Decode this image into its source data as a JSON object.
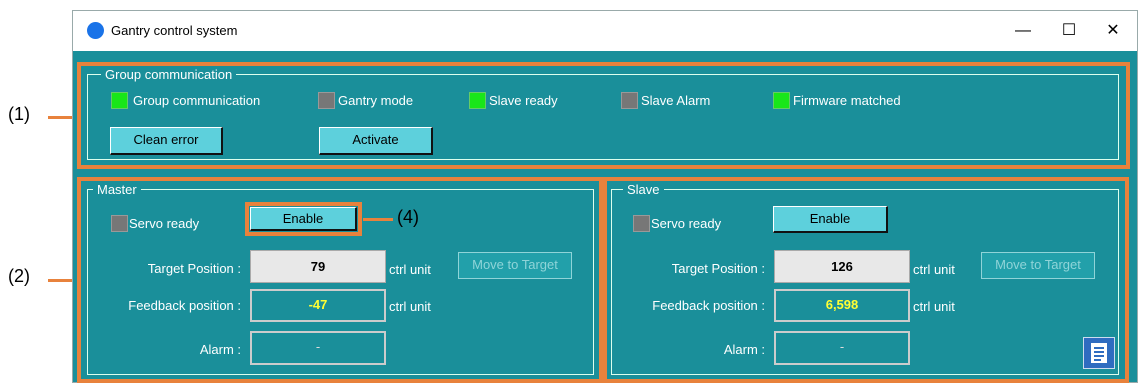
{
  "window": {
    "title": "Gantry control system",
    "minimize": "—",
    "maximize": "☐",
    "close": "✕"
  },
  "callouts": {
    "c1": "(1)",
    "c2": "(2)",
    "c4": "(4)"
  },
  "group_comm": {
    "legend": "Group communication",
    "indicators": [
      {
        "label": "Group communication",
        "state": "on"
      },
      {
        "label": "Gantry mode",
        "state": "off"
      },
      {
        "label": "Slave ready",
        "state": "on"
      },
      {
        "label": "Slave Alarm",
        "state": "off"
      },
      {
        "label": "Firmware matched",
        "state": "on"
      }
    ],
    "clean_error": "Clean error",
    "activate": "Activate"
  },
  "master": {
    "legend": "Master",
    "servo_ready": "Servo ready",
    "enable": "Enable",
    "target_label": "Target Position :",
    "target_value": "79",
    "unit": "ctrl unit",
    "move": "Move to Target",
    "feedback_label": "Feedback position :",
    "feedback_value": "-47",
    "alarm_label": "Alarm :",
    "alarm_value": "-"
  },
  "slave": {
    "legend": "Slave",
    "servo_ready": "Servo ready",
    "enable": "Enable",
    "target_label": "Target Position :",
    "target_value": "126",
    "unit": "ctrl unit",
    "move": "Move to Target",
    "feedback_label": "Feedback position :",
    "feedback_value": "6,598",
    "alarm_label": "Alarm :",
    "alarm_value": "-"
  },
  "icons": {
    "app": "gantry-app-icon",
    "notes": "notes-icon"
  },
  "colors": {
    "panel": "#1a8f9a",
    "led_on": "#19e619",
    "led_off": "#777777",
    "highlight": "#e8823c",
    "value_yellow": "#ffff33"
  }
}
